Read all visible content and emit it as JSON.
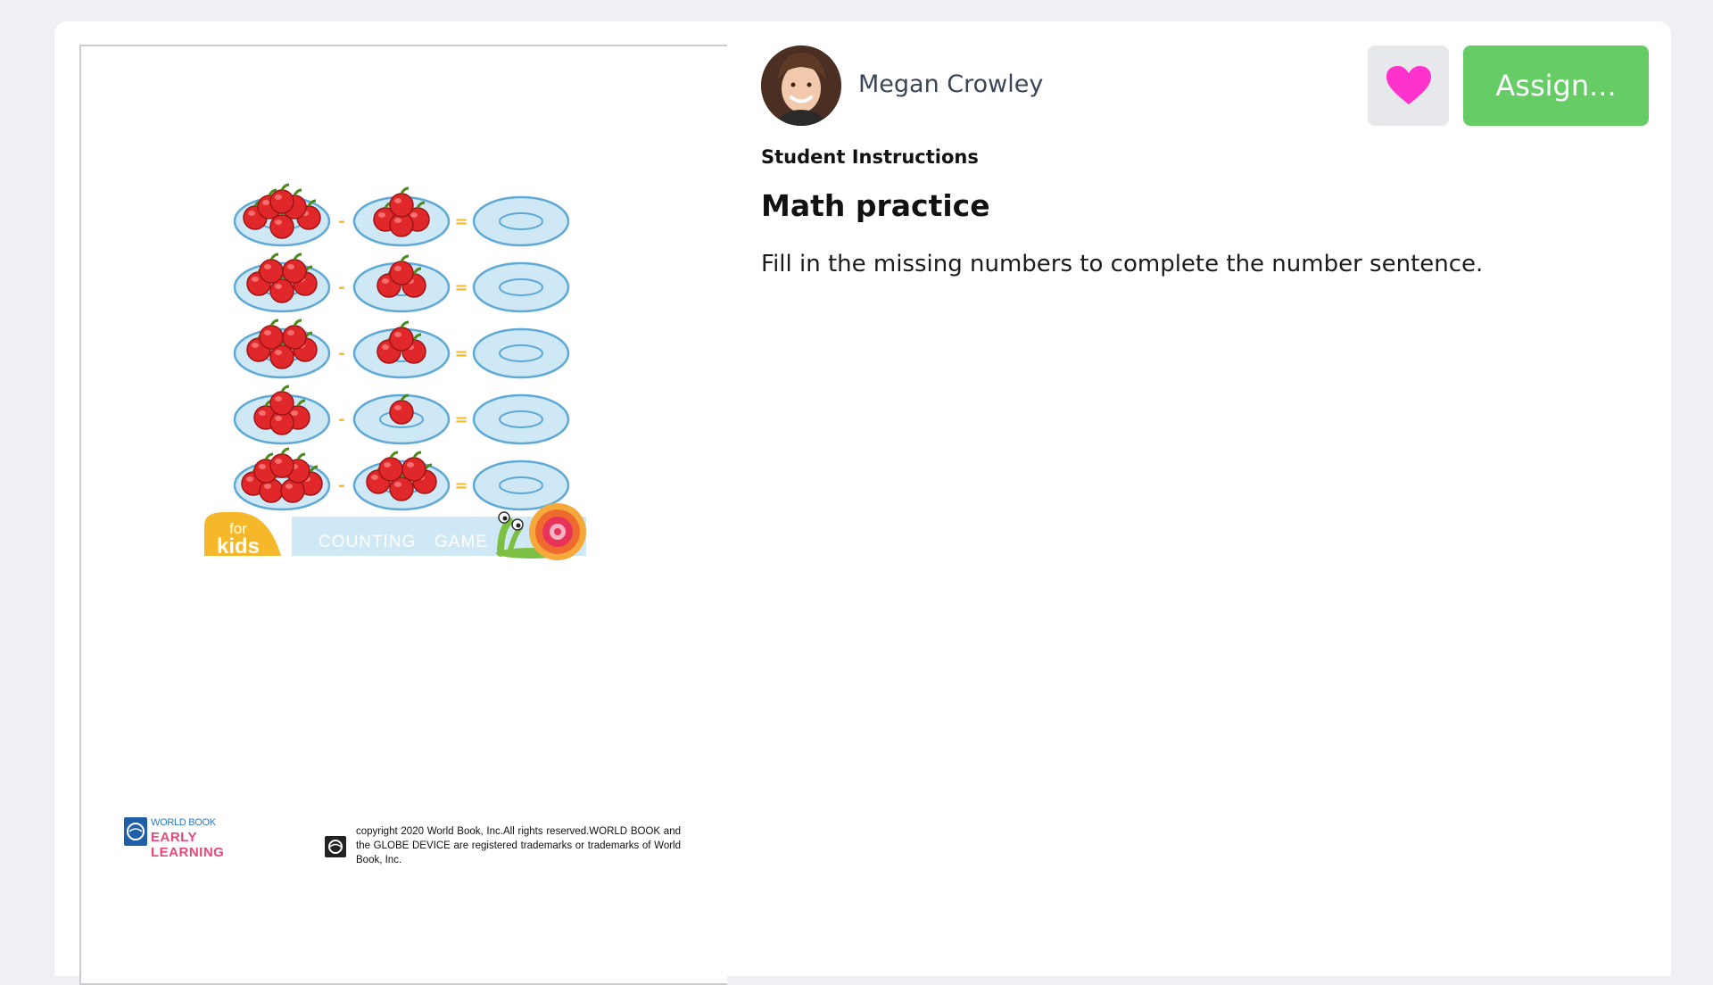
{
  "author": {
    "name": "Megan Crowley"
  },
  "actions": {
    "favorite_icon": "heart-icon",
    "assign_label": "Assign..."
  },
  "instructions": {
    "section_label": "Student Instructions",
    "title": "Math practice",
    "body": "Fill in the missing numbers to complete the number sentence."
  },
  "worksheet": {
    "banner": {
      "badge_top": "for",
      "badge_bottom": "kids",
      "word1": "COUNTING",
      "word2": "GAME"
    },
    "logo": {
      "line1": "WORLD BOOK",
      "line2": "EARLY LEARNING"
    },
    "copyright": "copyright 2020 World Book, Inc.All rights reserved.WORLD BOOK and the GLOBE DEVICE are registered trademarks or trademarks of World Book, Inc.",
    "minus_sign": "-",
    "equals_sign": "="
  },
  "colors": {
    "assign": "#66cc66",
    "heart": "#ff33cc",
    "plate": "#cfe8f6",
    "apple": "#e0282a",
    "banner_yellow": "#f6b82b",
    "banner_blue": "#cfe8f6"
  }
}
